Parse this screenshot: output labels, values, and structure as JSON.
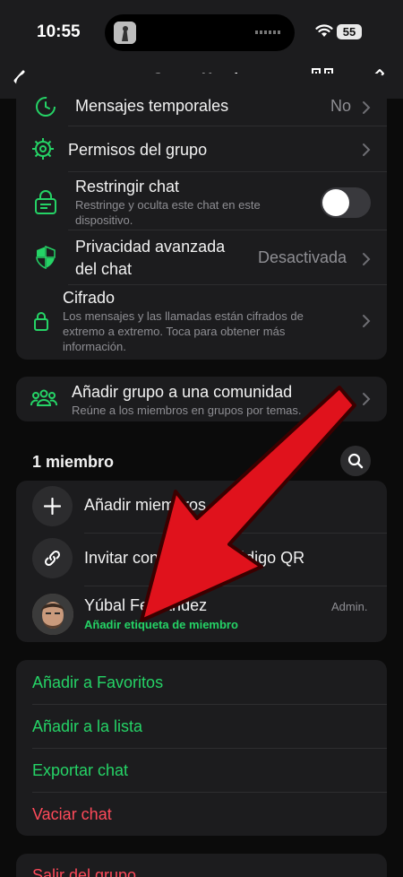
{
  "status_bar": {
    "time": "10:55",
    "battery": "55"
  },
  "nav": {
    "title": "Grupo Xataka"
  },
  "settings": {
    "temp_messages": {
      "label": "Mensajes temporales",
      "value": "No"
    },
    "permissions": {
      "label": "Permisos del grupo"
    },
    "restrict": {
      "label": "Restringir chat",
      "sub": "Restringe y oculta este chat en este dispositivo.",
      "enabled": false
    },
    "privacy": {
      "label_line1": "Privacidad avanzada",
      "label_line2": "del chat",
      "value": "Desactivada"
    },
    "encryption": {
      "label": "Cifrado",
      "sub": "Los mensajes y las llamadas están cifrados de extremo a extremo. Toca para obtener más información."
    }
  },
  "community": {
    "label": "Añadir grupo a una comunidad",
    "sub": "Reúne a los miembros en grupos por temas."
  },
  "members": {
    "title": "1 miembro",
    "add_label": "Añadir miembros",
    "invite_label": "Invitar con enlace o código QR",
    "member": {
      "name": "Yúbal Fernández",
      "tag": "Añadir etiqueta de miembro",
      "role": "Admin."
    }
  },
  "actions": {
    "favorites": "Añadir a Favoritos",
    "list": "Añadir a la lista",
    "export": "Exportar chat",
    "clear": "Vaciar chat"
  },
  "exit": {
    "label": "Salir del grupo"
  },
  "colors": {
    "accent": "#25d366",
    "danger": "#ff4a5a",
    "annotation_arrow": "#e0121c",
    "card": "#1c1c1e"
  }
}
